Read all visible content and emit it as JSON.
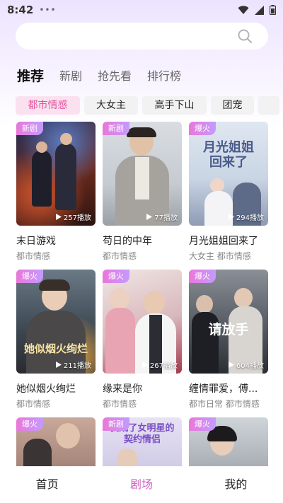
{
  "status_bar": {
    "time": "8:42",
    "dots": "•••"
  },
  "search": {
    "placeholder": ""
  },
  "tabs": [
    {
      "label": "推荐"
    },
    {
      "label": "新剧"
    },
    {
      "label": "抢先看"
    },
    {
      "label": "排行榜"
    }
  ],
  "categories": [
    {
      "label": "都市情感"
    },
    {
      "label": "大女主"
    },
    {
      "label": "高手下山"
    },
    {
      "label": "团宠"
    }
  ],
  "dramas": [
    {
      "title": "末日游戏",
      "tags": "都市情感",
      "badge": "新剧",
      "plays": "257播放"
    },
    {
      "title": "苟日的中年",
      "tags": "都市情感",
      "badge": "新剧",
      "plays": "77播放"
    },
    {
      "title": "月光姐姐回来了",
      "tags": "大女主 都市情感",
      "badge": "爆火",
      "plays": "294播放",
      "poster_text": "月光姐姐回来了"
    },
    {
      "title": "她似烟火绚烂",
      "tags": "都市情感",
      "badge": "爆火",
      "plays": "211播放",
      "poster_text": "她似烟火绚烂"
    },
    {
      "title": "缘来是你",
      "tags": "都市情感",
      "badge": "爆火",
      "plays": "267播放"
    },
    {
      "title": "缠情罪爱，傅...",
      "tags": "都市日常 都市情感",
      "badge": "爆火",
      "plays": "604播放",
      "poster_text": "请放手"
    },
    {
      "title": "",
      "tags": "",
      "badge": "爆火",
      "plays": ""
    },
    {
      "title": "",
      "tags": "",
      "badge": "新剧",
      "plays": "",
      "poster_text": "我成了女明星的契约情侣"
    },
    {
      "title": "",
      "tags": "",
      "badge": "爆火",
      "plays": ""
    }
  ],
  "bottom_nav": [
    {
      "label": "首页"
    },
    {
      "label": "剧场"
    },
    {
      "label": "我的"
    }
  ],
  "colors": {
    "accent": "#d060c4",
    "chip_active_bg": "#fbe1ef",
    "chip_active_text": "#e0579e"
  }
}
